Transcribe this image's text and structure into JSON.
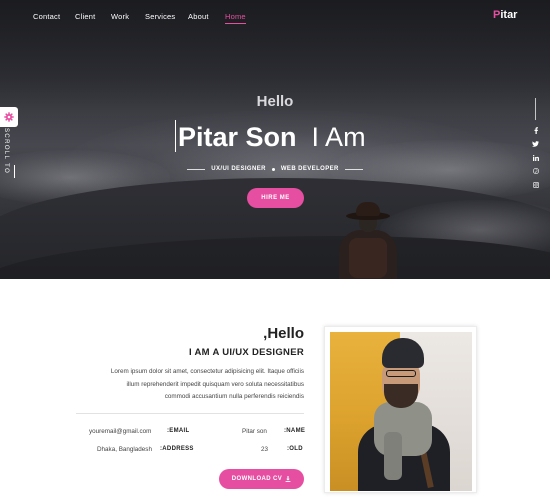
{
  "nav": {
    "items": [
      "Contact",
      "Client",
      "Work",
      "Services",
      "About",
      "Home"
    ],
    "active": "Home",
    "logo_initial": "P",
    "logo_rest": "itar"
  },
  "sidebar": {
    "scroll_label": "SCROLL TO",
    "settings_icon": "gear-icon"
  },
  "socials": [
    "facebook-icon",
    "twitter-icon",
    "linkedin-icon",
    "pinterest-icon",
    "instagram-icon"
  ],
  "hero": {
    "greeting": "Hello",
    "name": "Pitar Son",
    "tagline": "I Am",
    "role_1": "UX/UI DESIGNER",
    "role_2": "WEB DEVELOPER",
    "cta_label": "HIRE ME"
  },
  "about": {
    "greeting": ",Hello",
    "role": "I AM A UI/UX DESIGNER",
    "bio_line_1": "Lorem ipsum dolor sit amet, consectetur adipisicing elit. Itaque officiis",
    "bio_line_2": "illum reprehenderit impedit quisquam vero soluta necessitatibus",
    "bio_line_3": "commodi accusantium nulla perferendis reiciendis",
    "email_label": ":EMAIL",
    "email_value": "youremail@gmail.com",
    "name_label": ":NAME",
    "name_value": "Pitar son",
    "address_label": ":ADDRESS",
    "address_value": "Dhaka, Bangladesh",
    "old_label": ":OLD",
    "old_value": "23",
    "download_label": "DOWNLOAD CV"
  },
  "colors": {
    "accent": "#e64ea1",
    "hero_dark": "#2b2c31",
    "text_dark": "#222222"
  }
}
